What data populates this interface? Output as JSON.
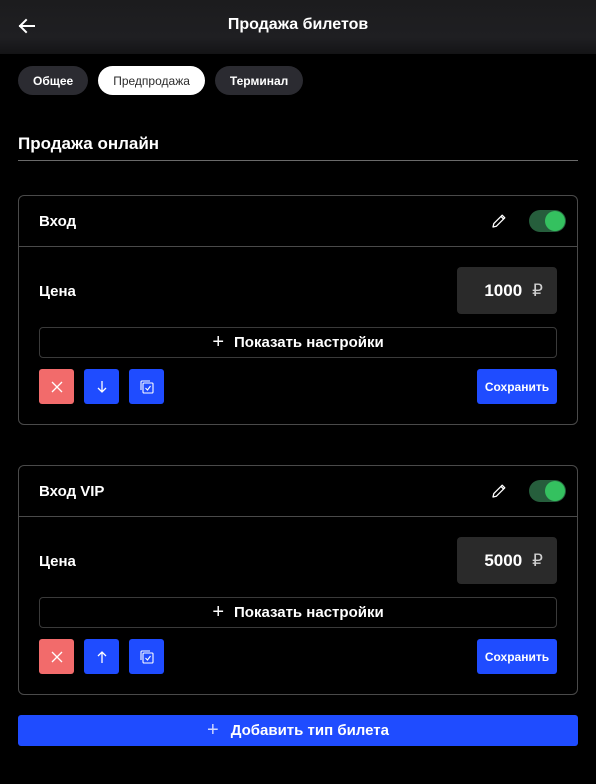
{
  "header": {
    "title": "Продажа билетов",
    "back_icon": "arrow-left-icon"
  },
  "tabs": [
    {
      "label": "Общее",
      "active": false
    },
    {
      "label": "Предпродажа",
      "active": true
    },
    {
      "label": "Терминал",
      "active": false
    }
  ],
  "section": {
    "title": "Продажа онлайн"
  },
  "tickets": [
    {
      "name": "Вход",
      "enabled": true,
      "price_label": "Цена",
      "price": "1000",
      "currency": "₽",
      "settings_label": "Показать настройки",
      "move_direction": "down",
      "save_label": "Сохранить"
    },
    {
      "name": "Вход VIP",
      "enabled": true,
      "price_label": "Цена",
      "price": "5000",
      "currency": "₽",
      "settings_label": "Показать настройки",
      "move_direction": "up",
      "save_label": "Сохранить"
    }
  ],
  "add_ticket": {
    "label": "Добавить тип билета"
  },
  "colors": {
    "background": "#000000",
    "accent_blue": "#1f4cff",
    "delete_red": "#f26b6b",
    "toggle_on": "#34c15f"
  }
}
